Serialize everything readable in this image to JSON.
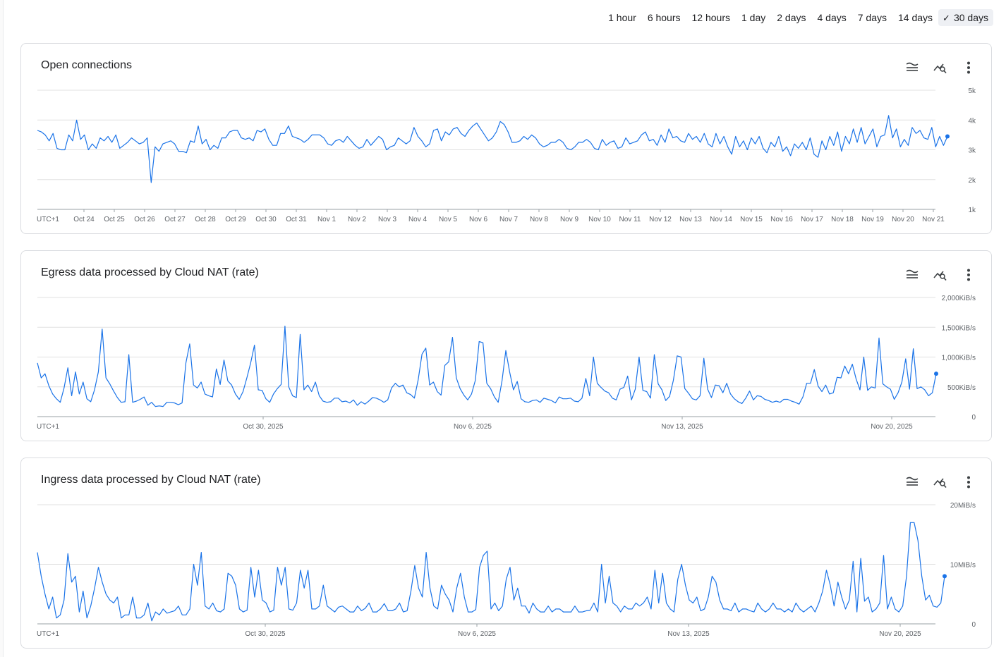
{
  "time_ranges": {
    "options": [
      "1 hour",
      "6 hours",
      "12 hours",
      "1 day",
      "2 days",
      "4 days",
      "7 days",
      "14 days",
      "30 days"
    ],
    "selected": "30 days"
  },
  "icons": {
    "legend": "legend-icon",
    "explore": "explore-icon",
    "more": "more-vert-icon"
  },
  "colors": {
    "line": "#1a73e8",
    "grid": "#e0e0e0",
    "axis": "#9aa0a6"
  },
  "cards": [
    {
      "title": "Open connections",
      "chart_data": {
        "type": "line",
        "timezone_label": "UTC+1",
        "x_tick_labels": [
          "Oct 24",
          "Oct 25",
          "Oct 26",
          "Oct 27",
          "Oct 28",
          "Oct 29",
          "Oct 30",
          "Oct 31",
          "Nov 1",
          "Nov 2",
          "Nov 3",
          "Nov 4",
          "Nov 5",
          "Nov 6",
          "Nov 7",
          "Nov 8",
          "Nov 9",
          "Nov 10",
          "Nov 11",
          "Nov 12",
          "Nov 13",
          "Nov 14",
          "Nov 15",
          "Nov 16",
          "Nov 17",
          "Nov 18",
          "Nov 19",
          "Nov 20",
          "Nov 21"
        ],
        "y_tick_labels": [
          "1k",
          "2k",
          "3k",
          "4k",
          "5k"
        ],
        "ylim": [
          1000,
          5000
        ],
        "series": [
          {
            "values": [
              3650,
              3600,
              3500,
              3300,
              3550,
              3050,
              3000,
              3000,
              3500,
              3300,
              4000,
              3350,
              3500,
              3000,
              3200,
              3050,
              3400,
              3300,
              3450,
              3250,
              3500,
              3050,
              3150,
              3250,
              3400,
              3300,
              3200,
              3250,
              3400,
              1900,
              3100,
              2950,
              3200,
              3250,
              3300,
              3200,
              2950,
              2950,
              2900,
              3300,
              3250,
              3800,
              3200,
              3350,
              3000,
              3150,
              3050,
              3400,
              3400,
              3600,
              3650,
              3650,
              3400,
              3350,
              3400,
              3300,
              3650,
              3600,
              3700,
              3350,
              3150,
              3150,
              3550,
              3550,
              3800,
              3450,
              3400,
              3350,
              3250,
              3350,
              3500,
              3500,
              3500,
              3400,
              3200,
              3150,
              3300,
              3350,
              3250,
              3450,
              3300,
              3150,
              3050,
              3100,
              3350,
              3150,
              3300,
              3450,
              3350,
              3000,
              3100,
              3150,
              3400,
              3300,
              3200,
              3300,
              3750,
              3450,
              3300,
              3100,
              3200,
              3650,
              3700,
              3300,
              3600,
              3500,
              3700,
              3750,
              3550,
              3450,
              3650,
              3800,
              3900,
              3700,
              3500,
              3300,
              3400,
              3600,
              3950,
              3850,
              3600,
              3250,
              3250,
              3300,
              3450,
              3350,
              3500,
              3400,
              3200,
              3100,
              3150,
              3250,
              3250,
              3350,
              3250,
              3050,
              3000,
              3100,
              3250,
              3250,
              3350,
              3250,
              3050,
              3000,
              3350,
              3150,
              3250,
              3300,
              3050,
              3100,
              3400,
              3200,
              3250,
              3300,
              3500,
              3600,
              3300,
              3350,
              3150,
              3500,
              3250,
              3700,
              3400,
              3450,
              3300,
              3250,
              3550,
              3350,
              3450,
              3250,
              3550,
              3200,
              3100,
              3550,
              3200,
              3450,
              3100,
              2850,
              3450,
              3100,
              3300,
              3000,
              3400,
              3200,
              3450,
              3050,
              2900,
              3250,
              3100,
              3450,
              2950,
              3100,
              2800,
              3200,
              3050,
              3250,
              3000,
              3400,
              2850,
              2750,
              3300,
              3000,
              3450,
              3150,
              3600,
              2950,
              3450,
              3200,
              3700,
              3250,
              3750,
              3200,
              3450,
              3700,
              3100,
              3450,
              3500,
              4150,
              3400,
              3700,
              3100,
              3350,
              3150,
              3750,
              3550,
              3650,
              3400,
              3350,
              3750,
              3100,
              3450,
              3150,
              3450
            ]
          }
        ]
      }
    },
    {
      "title": "Egress data processed by Cloud NAT (rate)",
      "chart_data": {
        "type": "line",
        "timezone_label": "UTC+1",
        "x_tick_labels": [
          "Oct 30, 2025",
          "Nov 6, 2025",
          "Nov 13, 2025",
          "Nov 20, 2025"
        ],
        "y_tick_labels": [
          "0",
          "500KiB/s",
          "1,000KiB/s",
          "1,500KiB/s",
          "2,000KiB/s"
        ],
        "ylim": [
          0,
          2000
        ],
        "series": [
          {
            "values": [
              900,
              650,
              720,
              520,
              380,
              300,
              240,
              480,
              820,
              350,
              750,
              380,
              580,
              300,
              250,
              450,
              750,
              1470,
              650,
              550,
              430,
              320,
              240,
              250,
              1040,
              240,
              260,
              290,
              330,
              190,
              240,
              170,
              180,
              170,
              240,
              240,
              230,
              200,
              230,
              900,
              1220,
              530,
              480,
              580,
              380,
              350,
              330,
              800,
              540,
              950,
              600,
              530,
              380,
              290,
              420,
              650,
              900,
              1200,
              450,
              440,
              300,
              240,
              380,
              470,
              540,
              1520,
              500,
              350,
              320,
              1380,
              450,
              530,
              420,
              580,
              350,
              260,
              240,
              250,
              310,
              310,
              250,
              260,
              230,
              280,
              190,
              250,
              210,
              260,
              320,
              310,
              280,
              240,
              280,
              480,
              560,
              500,
              530,
              400,
              370,
              310,
              620,
              1050,
              1150,
              530,
              580,
              420,
              360,
              860,
              920,
              1330,
              650,
              470,
              360,
              280,
              380,
              610,
              1260,
              1240,
              560,
              470,
              330,
              240,
              600,
              1110,
              750,
              450,
              590,
              300,
              250,
              240,
              270,
              280,
              240,
              310,
              290,
              270,
              230,
              330,
              300,
              300,
              310,
              260,
              250,
              310,
              640,
              350,
              1000,
              560,
              490,
              430,
              400,
              310,
              280,
              460,
              490,
              680,
              280,
              460,
              1000,
              440,
              420,
              310,
              1040,
              550,
              450,
              270,
              340,
              610,
              1020,
              1000,
              470,
              390,
              300,
              280,
              350,
              980,
              460,
              320,
              530,
              520,
              400,
              560,
              380,
              300,
              250,
              220,
              310,
              430,
              280,
              350,
              340,
              290,
              270,
              240,
              260,
              240,
              290,
              290,
              260,
              240,
              210,
              330,
              560,
              560,
              790,
              510,
              420,
              530,
              380,
              400,
              660,
              650,
              850,
              720,
              880,
              630,
              450,
              1000,
              440,
              500,
              480,
              1320,
              550,
              500,
              460,
              290,
              400,
              580,
              970,
              460,
              1140,
              470,
              500,
              450,
              350,
              400,
              720
            ]
          }
        ]
      }
    },
    {
      "title": "Ingress data processed by Cloud NAT (rate)",
      "chart_data": {
        "type": "line",
        "timezone_label": "UTC+1",
        "x_tick_labels": [
          "Oct 30, 2025",
          "Nov 6, 2025",
          "Nov 13, 2025",
          "Nov 20, 2025"
        ],
        "y_tick_labels": [
          "0",
          "10MiB/s",
          "20MiB/s"
        ],
        "ylim": [
          0,
          20
        ],
        "series": [
          {
            "values": [
              12,
              8,
              5,
              2.5,
              4.5,
              1,
              1.5,
              4,
              11.8,
              7,
              8,
              2,
              5.5,
              1,
              3,
              6,
              9.5,
              7,
              5,
              4,
              3.5,
              4.5,
              1,
              1.5,
              1.5,
              4.5,
              1,
              1,
              1.5,
              3.5,
              0.5,
              2,
              1.5,
              2.5,
              1.8,
              2,
              2.2,
              3,
              1.5,
              1.5,
              2.5,
              10,
              6.5,
              12,
              3,
              2.5,
              3.5,
              2.2,
              2,
              2.5,
              8.5,
              8,
              6.5,
              2.5,
              2,
              2.3,
              9.5,
              4.5,
              9,
              4,
              3.5,
              2,
              2.3,
              9.5,
              6.5,
              9.5,
              2.5,
              2.3,
              3.5,
              9,
              6,
              9,
              2.5,
              2.5,
              3,
              6.5,
              3,
              2.5,
              2,
              2.8,
              3,
              2.5,
              2,
              2,
              3,
              2.2,
              2.6,
              3.5,
              2,
              2,
              2.5,
              3.4,
              2.2,
              2.2,
              2.5,
              3.5,
              2,
              2.2,
              5.5,
              9.8,
              6,
              4.5,
              12,
              6,
              3,
              2.5,
              6.5,
              5,
              4,
              2,
              6,
              8.5,
              4.5,
              2,
              2,
              2.4,
              9.5,
              11.5,
              12.2,
              2.5,
              3.5,
              2.2,
              3,
              7.5,
              9.5,
              4,
              6,
              3,
              3,
              1.8,
              3.5,
              2.5,
              2,
              2,
              3,
              2,
              2.5,
              2.5,
              2,
              2,
              2,
              3,
              2,
              2,
              2.2,
              2.3,
              3.5,
              2,
              10,
              3.5,
              8,
              3.5,
              3,
              2,
              3,
              2.5,
              2.5,
              3.5,
              3,
              3.5,
              4.5,
              2.5,
              9,
              3.5,
              8.5,
              3.5,
              2.5,
              2,
              7.5,
              10,
              6.5,
              4,
              3.5,
              4.5,
              2.2,
              2.5,
              4.5,
              8,
              7,
              4,
              2.5,
              2.5,
              2.2,
              3.5,
              2,
              2.5,
              2.5,
              2.2,
              2,
              3.5,
              2.5,
              2,
              2.5,
              3.5,
              2.5,
              2.5,
              2,
              2.5,
              2,
              3.5,
              2.5,
              2,
              2.5,
              3,
              2,
              3.5,
              5.5,
              9,
              6.5,
              3,
              7,
              4.5,
              2.5,
              4,
              10.5,
              2,
              11,
              3.8,
              4.5,
              2,
              2.5,
              3.5,
              11.5,
              2.5,
              4.5,
              2.5,
              2,
              3,
              8,
              17,
              17,
              14,
              8,
              4,
              4.8,
              3,
              2.8,
              3.5,
              8
            ]
          }
        ]
      }
    }
  ]
}
